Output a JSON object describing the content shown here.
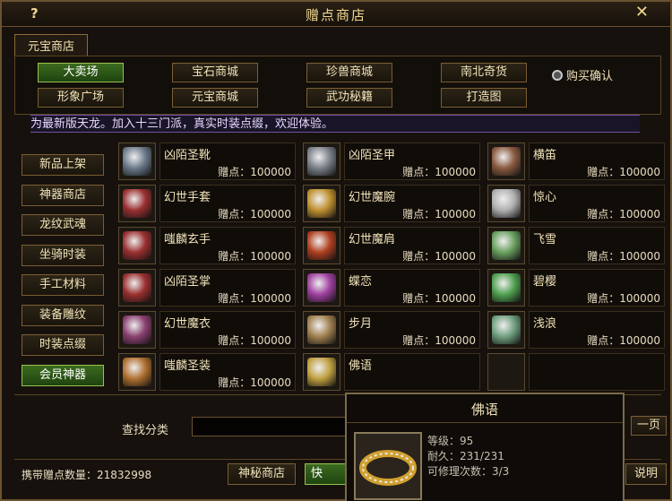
{
  "window": {
    "title": "赠点商店",
    "help_label": "?",
    "close_label": "✕"
  },
  "tabs": [
    {
      "label": "元宝商店"
    }
  ],
  "categories": [
    {
      "label": "大卖场",
      "active": true
    },
    {
      "label": "宝石商城"
    },
    {
      "label": "珍兽商城"
    },
    {
      "label": "南北奇货"
    },
    {
      "label": "形象广场"
    },
    {
      "label": "元宝商城"
    },
    {
      "label": "武功秘籍"
    },
    {
      "label": "打造图"
    }
  ],
  "buy_confirm": {
    "label": "购买确认"
  },
  "marquee": "为最新版天龙。加入十三门派，真实时装点缀，欢迎体验。",
  "left_nav": [
    {
      "label": "新品上架"
    },
    {
      "label": "神器商店"
    },
    {
      "label": "龙纹武魂"
    },
    {
      "label": "坐骑时装"
    },
    {
      "label": "手工材料"
    },
    {
      "label": "装备雕纹"
    },
    {
      "label": "时装点缀"
    },
    {
      "label": "会员神器",
      "active": true
    }
  ],
  "items": [
    {
      "name": "凶陌圣靴",
      "price": "赠点：100000",
      "icon": "boots-icon",
      "color": "#6b7a8a"
    },
    {
      "name": "凶陌圣甲",
      "price": "赠点：100000",
      "icon": "armor-icon",
      "color": "#7a8088"
    },
    {
      "name": "横笛",
      "price": "赠点：100000",
      "icon": "flute-icon",
      "color": "#8a5a40"
    },
    {
      "name": "幻世手套",
      "price": "赠点：100000",
      "icon": "gloves-icon",
      "color": "#9a3030"
    },
    {
      "name": "幻世魔腕",
      "price": "赠点：100000",
      "icon": "bracer-icon",
      "color": "#c09030"
    },
    {
      "name": "惊心",
      "price": "赠点：100000",
      "icon": "ring-icon",
      "color": "#b0b0b0"
    },
    {
      "name": "嗤麟玄手",
      "price": "赠点：100000",
      "icon": "gloves-icon",
      "color": "#9a3030"
    },
    {
      "name": "幻世魔肩",
      "price": "赠点：100000",
      "icon": "shoulder-icon",
      "color": "#b04020"
    },
    {
      "name": "飞雪",
      "price": "赠点：100000",
      "icon": "jade-pendant-icon",
      "color": "#6aa060"
    },
    {
      "name": "凶陌圣掌",
      "price": "赠点：100000",
      "icon": "gloves-icon",
      "color": "#9a3030"
    },
    {
      "name": "蝶恋",
      "price": "赠点：100000",
      "icon": "necklace-icon",
      "color": "#a040a0"
    },
    {
      "name": "碧樱",
      "price": "赠点：100000",
      "icon": "jade-pendant-icon",
      "color": "#50a050"
    },
    {
      "name": "幻世魔衣",
      "price": "赠点：100000",
      "icon": "robe-icon",
      "color": "#8a4070"
    },
    {
      "name": "步月",
      "price": "赠点：100000",
      "icon": "belt-icon",
      "color": "#a08050"
    },
    {
      "name": "浅浪",
      "price": "赠点：100000",
      "icon": "jade-pendant-icon",
      "color": "#70a080"
    },
    {
      "name": "嗤麟圣装",
      "price": "赠点：100000",
      "icon": "armor-icon",
      "color": "#b07030"
    },
    {
      "name": "佛语",
      "price": "",
      "icon": "ring-icon",
      "color": "#c0a040"
    },
    {
      "name": "",
      "price": "",
      "icon": "empty-slot-icon",
      "color": "#222"
    }
  ],
  "search": {
    "label": "查找分类",
    "placeholder": ""
  },
  "next_page": "一页",
  "footer": {
    "points_label": "携带赠点数量：",
    "points_value": "21832998",
    "mystery_label": "神秘商店",
    "quick_label": "快速：",
    "explain_label": "说明"
  },
  "tooltip": {
    "title": "佛语",
    "lines": [
      "等级：95",
      "耐久：231/231",
      "可修理次数：3/3"
    ],
    "icon": "ring-icon"
  }
}
